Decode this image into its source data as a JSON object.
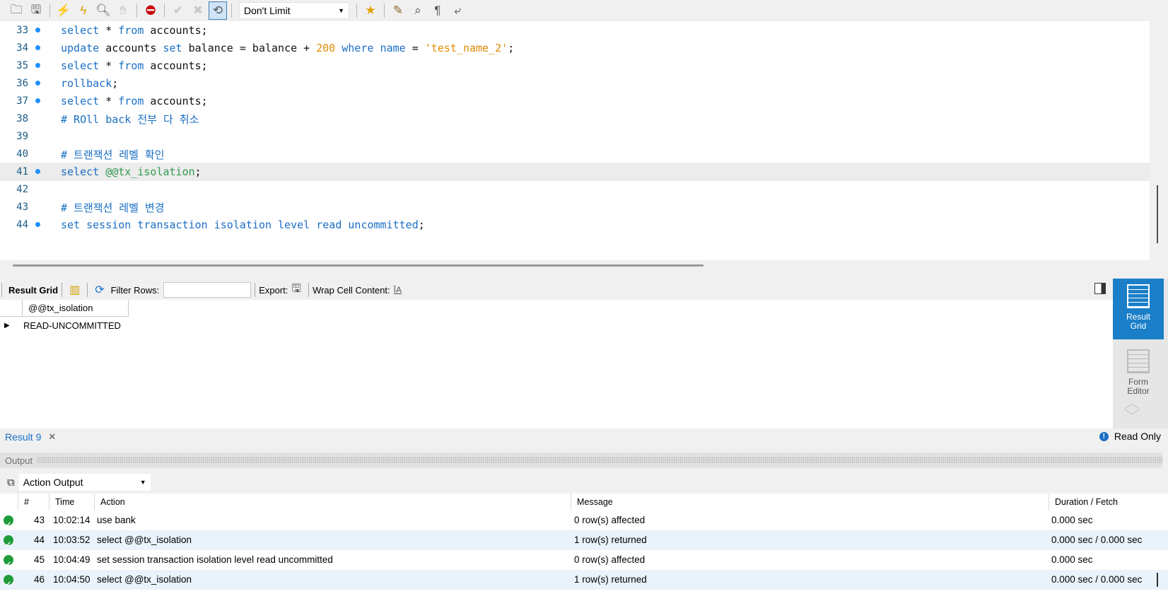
{
  "toolbar": {
    "icons": [
      "open-folder-icon",
      "save-icon",
      "execute-icon",
      "execute-current-icon",
      "explain-icon",
      "stop-icon",
      "toggle-error-icon",
      "commit-icon",
      "rollback-icon",
      "autocommit-icon",
      "bookmark-icon",
      "beautify-icon",
      "find-icon",
      "invisible-chars-icon",
      "wrap-icon"
    ],
    "limit": "Don't Limit"
  },
  "editor": {
    "lines": [
      {
        "num": "33",
        "dot": true
      },
      {
        "num": "34",
        "dot": true
      },
      {
        "num": "35",
        "dot": true
      },
      {
        "num": "36",
        "dot": true
      },
      {
        "num": "37",
        "dot": true
      },
      {
        "num": "38",
        "dot": false
      },
      {
        "num": "39",
        "dot": false
      },
      {
        "num": "40",
        "dot": false
      },
      {
        "num": "41",
        "dot": true,
        "current": true
      },
      {
        "num": "42",
        "dot": false
      },
      {
        "num": "43",
        "dot": false
      },
      {
        "num": "44",
        "dot": true
      }
    ],
    "code": {
      "l33": {
        "k1": "select",
        "t1": " * ",
        "k2": "from",
        "t2": " accounts;"
      },
      "l34": {
        "k1": "update",
        "t1": " accounts ",
        "k2": "set",
        "t2": " balance = balance + ",
        "n1": "200",
        "t3": " ",
        "k3": "where",
        "t4": " ",
        "k4": "name",
        "t5": " = ",
        "s1": "'test_name_2'",
        "t6": ";"
      },
      "l35": {
        "k1": "select",
        "t1": " * ",
        "k2": "from",
        "t2": " accounts;"
      },
      "l36": {
        "k1": "rollback",
        "t1": ";"
      },
      "l37": {
        "k1": "select",
        "t1": " * ",
        "k2": "from",
        "t2": " accounts;"
      },
      "l38": {
        "c1": "# ROll back 전부 다 취소"
      },
      "l40": {
        "c1": "# 트랜잭션 레벨 확인"
      },
      "l41": {
        "k1": "select",
        "t1": " ",
        "v1": "@@tx_isolation",
        "t2": ";"
      },
      "l43": {
        "c1": "# 트랜잭션 레벨 변경"
      },
      "l44": {
        "k1": "set session transaction isolation level read uncommitted",
        "t1": ";"
      }
    }
  },
  "result_toolbar": {
    "result_grid_label": "Result Grid",
    "filter_label": "Filter Rows:",
    "filter_value": "",
    "export_label": "Export:",
    "wrap_label": "Wrap Cell Content:"
  },
  "result_grid": {
    "columns": [
      "@@tx_isolation"
    ],
    "rows": [
      [
        "READ-UNCOMMITTED"
      ]
    ]
  },
  "side_panel": {
    "result_grid_line1": "Result",
    "result_grid_line2": "Grid",
    "form_editor_line1": "Form",
    "form_editor_line2": "Editor"
  },
  "result_tabs": {
    "tab_label": "Result 9",
    "read_only": "Read Only"
  },
  "output": {
    "title": "Output",
    "selector": "Action Output",
    "columns": {
      "num": "#",
      "time": "Time",
      "action": "Action",
      "message": "Message",
      "duration": "Duration / Fetch"
    },
    "rows": [
      {
        "num": "43",
        "time": "10:02:14",
        "action": "use bank",
        "message": "0 row(s) affected",
        "duration": "0.000 sec"
      },
      {
        "num": "44",
        "time": "10:03:52",
        "action": "select @@tx_isolation",
        "message": "1 row(s) returned",
        "duration": "0.000 sec / 0.000 sec"
      },
      {
        "num": "45",
        "time": "10:04:49",
        "action": "set session transaction isolation level read uncommitted",
        "message": "0 row(s) affected",
        "duration": "0.000 sec"
      },
      {
        "num": "46",
        "time": "10:04:50",
        "action": "select @@tx_isolation",
        "message": "1 row(s) returned",
        "duration": "0.000 sec / 0.000 sec"
      }
    ]
  }
}
